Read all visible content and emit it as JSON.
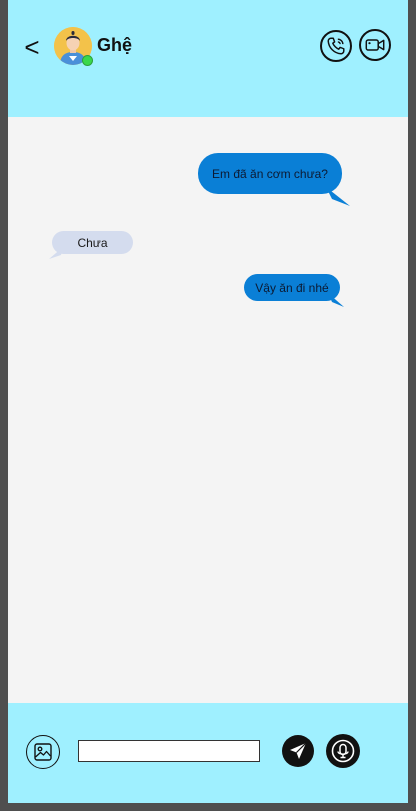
{
  "header": {
    "back_label": "<",
    "contact_name": "Ghệ",
    "call_icon": "phone-call-icon",
    "video_icon": "video-camera-icon",
    "status": "online"
  },
  "messages": [
    {
      "from": "me",
      "text": "Em đã ăn cơm chưa?"
    },
    {
      "from": "them",
      "text": "Chưa"
    },
    {
      "from": "me",
      "text": "Vậy ăn đi nhé"
    }
  ],
  "composer": {
    "input_value": "",
    "image_icon": "image-icon",
    "send_icon": "send-icon",
    "mic_icon": "microphone-icon"
  },
  "colors": {
    "header_bg": "#9ff0ff",
    "chat_bg": "#f4f4f4",
    "sent_bubble": "#0a7fd6",
    "received_bubble": "#d4dcee",
    "frame": "#4f4f4f"
  }
}
